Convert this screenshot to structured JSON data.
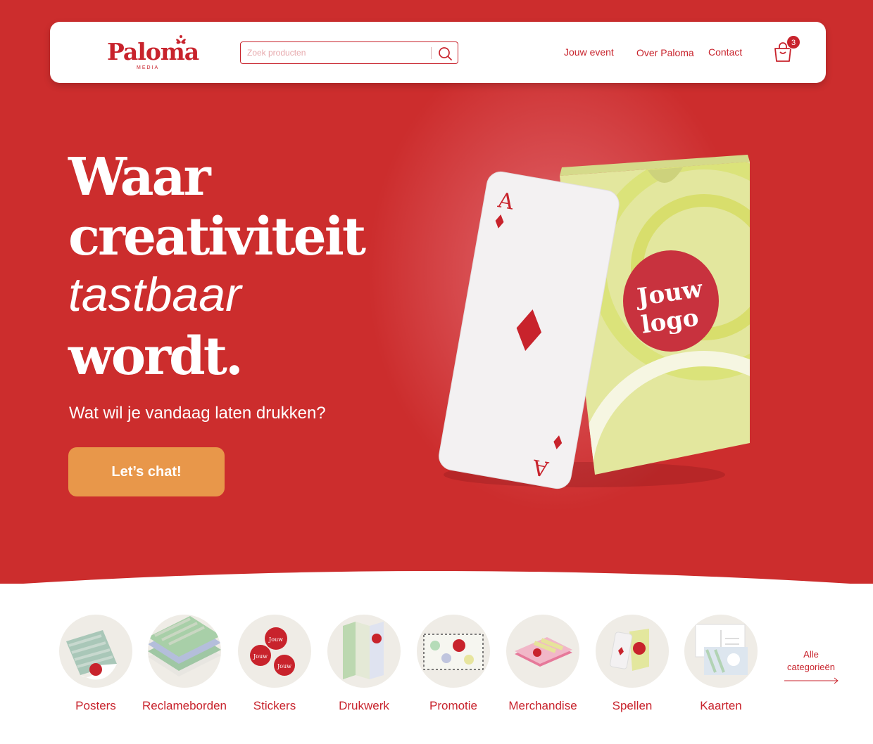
{
  "header": {
    "logo_text": "Paloma",
    "logo_subtext": "MEDIA",
    "search_placeholder": "Zoek producten",
    "nav": [
      "Jouw event",
      "Over Paloma",
      "Contact"
    ],
    "cart_count": "3"
  },
  "hero": {
    "line1": "Waar",
    "line2": "creativiteit",
    "line3": "tastbaar",
    "line4": "wordt.",
    "subtitle": "Wat wil je vandaag laten drukken?",
    "cta": "Let’s chat!",
    "product_logo_line1": "Jouw",
    "product_logo_line2": "logo",
    "card_rank": "A"
  },
  "categories": [
    {
      "label": "Posters",
      "icon": "poster-roll-icon"
    },
    {
      "label": "Reclameborden",
      "icon": "signboards-icon"
    },
    {
      "label": "Stickers",
      "icon": "stickers-icon"
    },
    {
      "label": "Drukwerk",
      "icon": "folder-icon"
    },
    {
      "label": "Promotie",
      "icon": "banner-icon"
    },
    {
      "label": "Merchandise",
      "icon": "towel-icon"
    },
    {
      "label": "Spellen",
      "icon": "playing-cards-icon"
    },
    {
      "label": "Kaarten",
      "icon": "postcards-icon"
    }
  ],
  "all_categories": "Alle categorieën",
  "colors": {
    "brand_red": "#cc2d2d",
    "cta_orange": "#e8974a",
    "pastel_yellow": "#e3e79e"
  }
}
